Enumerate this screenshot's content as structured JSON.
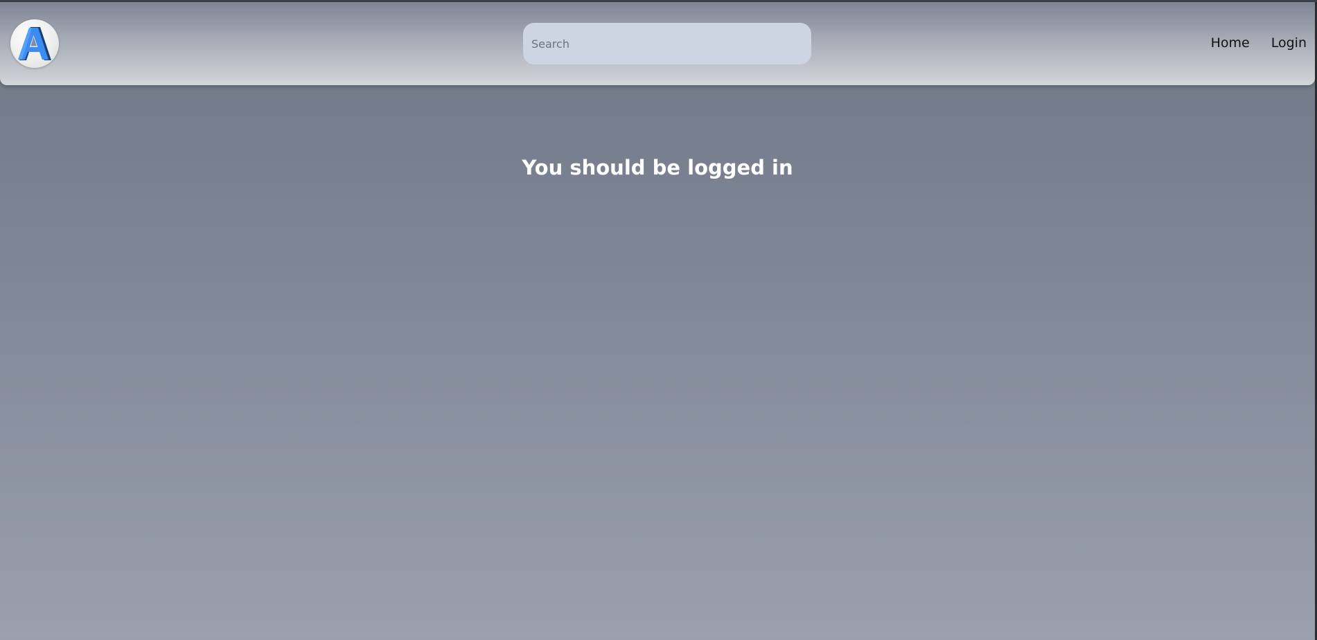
{
  "header": {
    "logo": {
      "icon": "letter-a-logo-icon",
      "letter": "A",
      "colors": {
        "front": "#3b8cf0",
        "side": "#1a3f7a"
      }
    },
    "search": {
      "placeholder": "Search",
      "value": ""
    },
    "nav": [
      {
        "label": "Home"
      },
      {
        "label": "Login"
      }
    ]
  },
  "main": {
    "message": "You should be logged in"
  }
}
